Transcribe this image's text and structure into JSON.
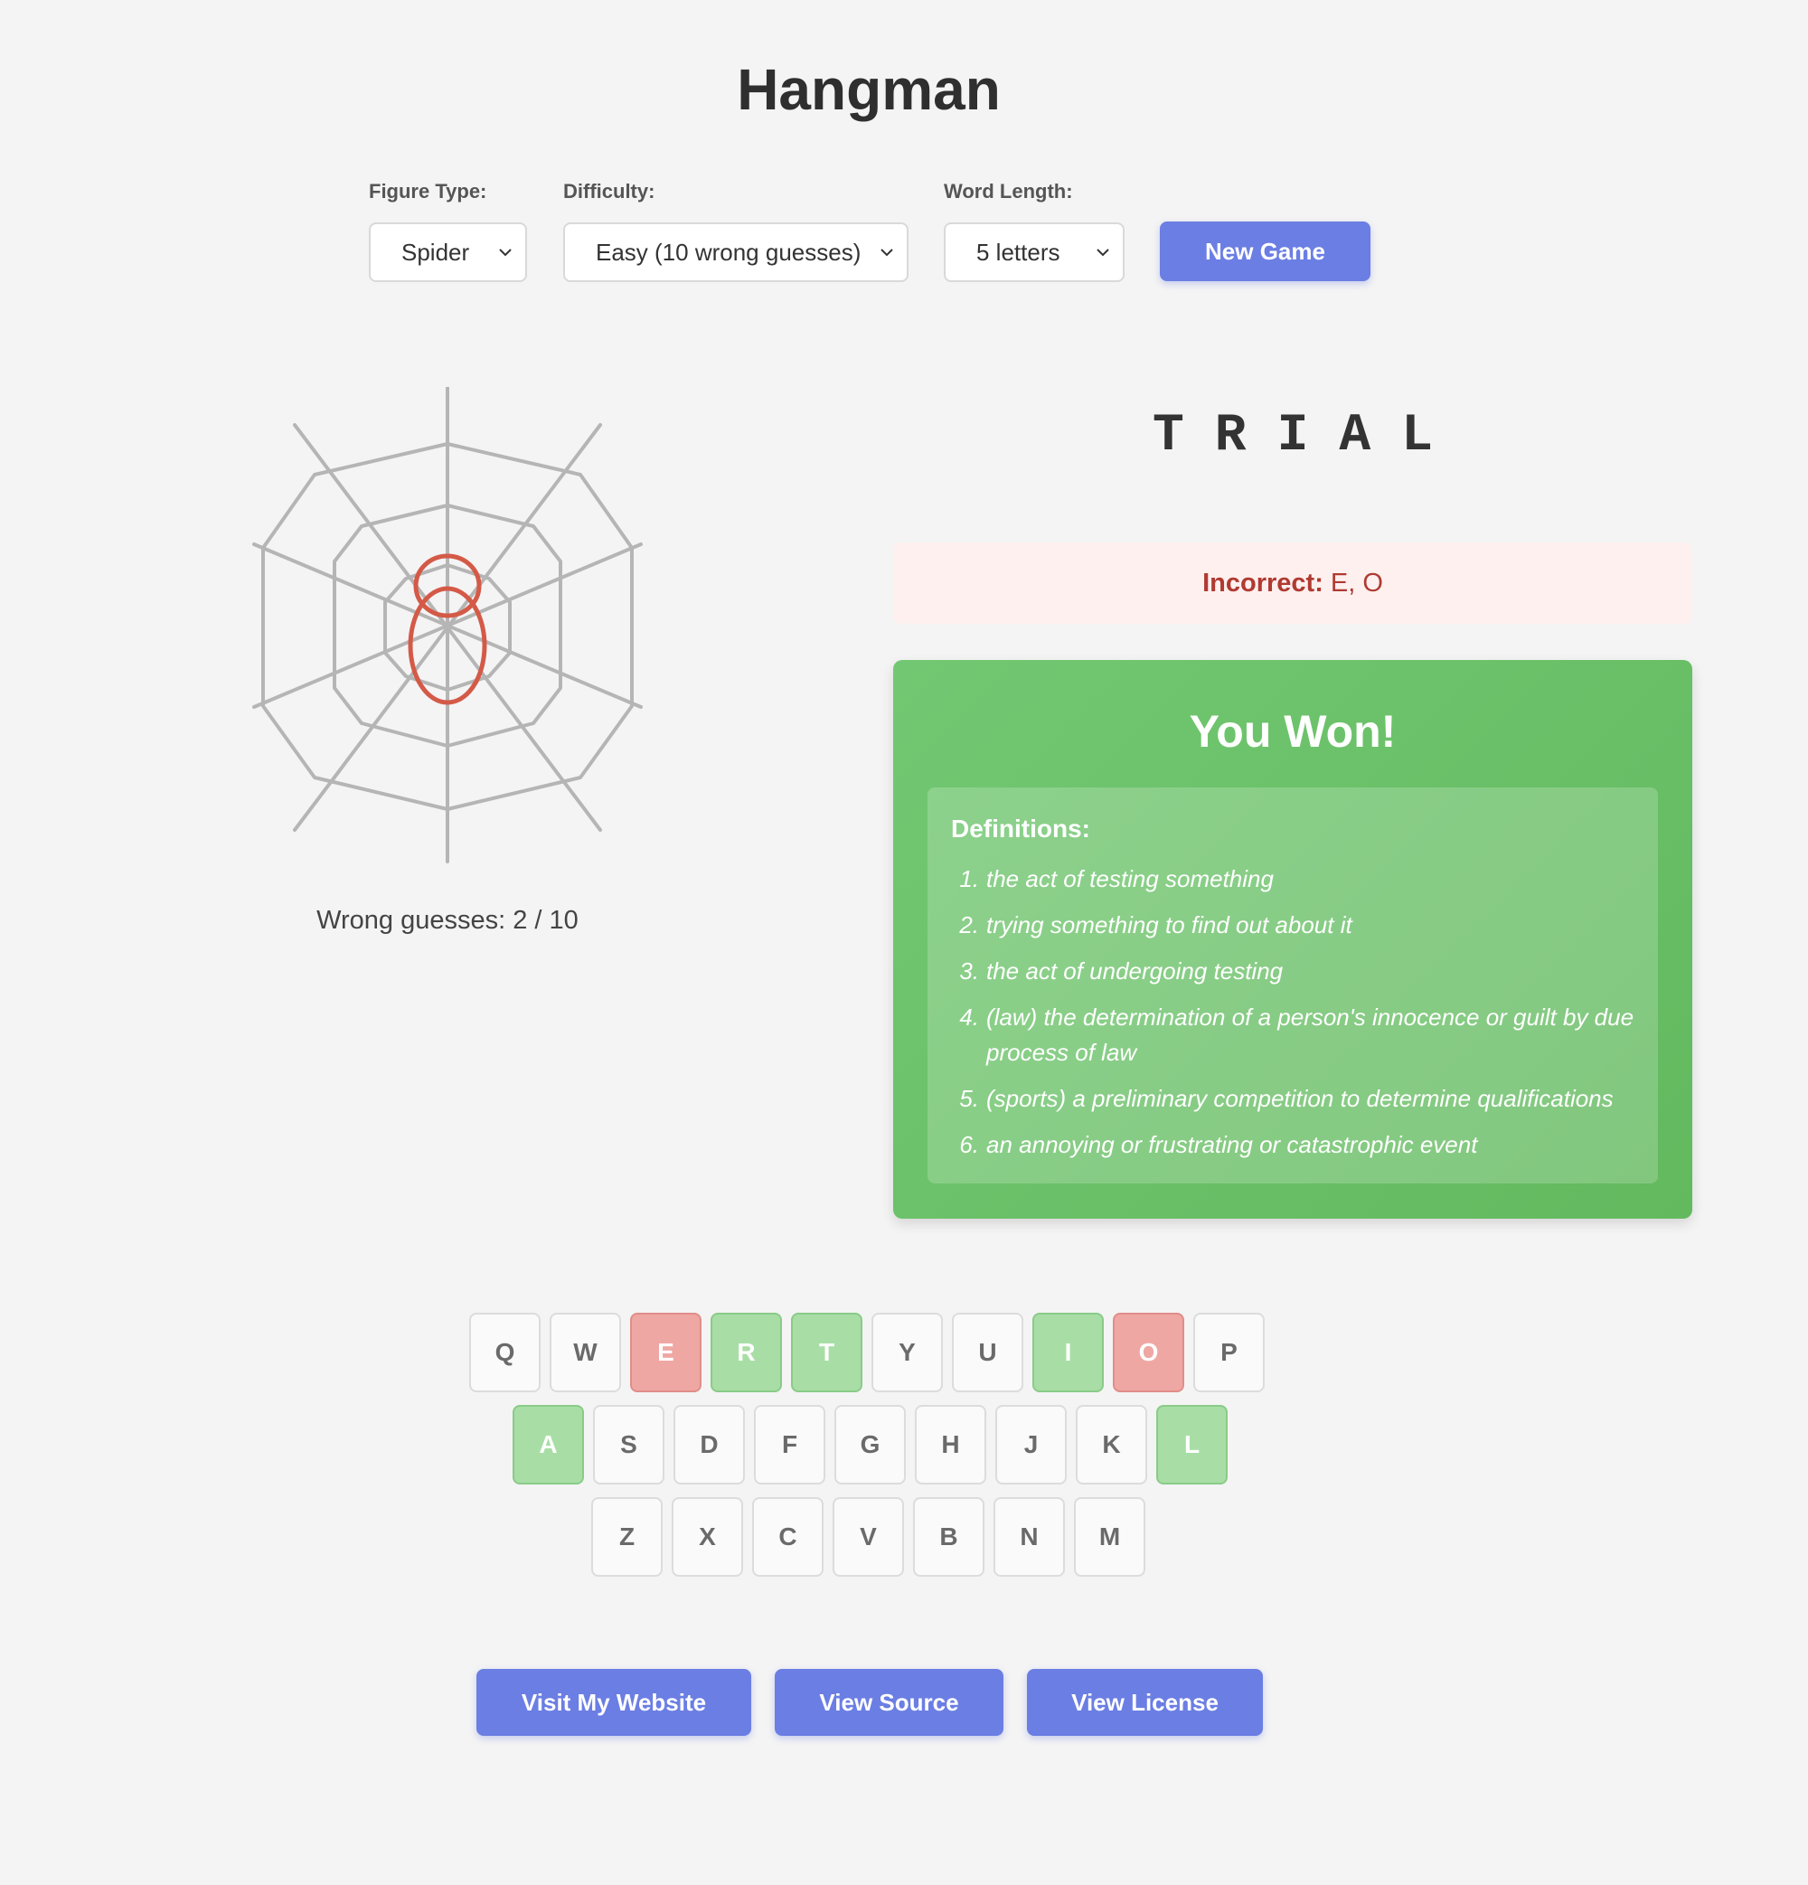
{
  "page": {
    "title": "Hangman"
  },
  "controls": {
    "figure_type": {
      "label": "Figure Type:",
      "value": "Spider"
    },
    "difficulty": {
      "label": "Difficulty:",
      "value": "Easy (10 wrong guesses)"
    },
    "word_length": {
      "label": "Word Length:",
      "value": "5 letters"
    },
    "new_game": "New Game"
  },
  "game": {
    "word": "TRIAL",
    "wrong_guesses_text": "Wrong guesses: 2 / 10",
    "incorrect_label": "Incorrect:",
    "incorrect_letters": "E, O"
  },
  "result": {
    "title": "You Won!",
    "definitions_heading": "Definitions:",
    "definitions": [
      "the act of testing something",
      "trying something to find out about it",
      "the act of undergoing testing",
      "(law) the determination of a person's innocence or guilt by due process of law",
      "(sports) a preliminary competition to determine qualifications",
      "an annoying or frustrating or catastrophic event"
    ]
  },
  "keyboard": {
    "rows": [
      [
        {
          "letter": "Q",
          "state": "unused"
        },
        {
          "letter": "W",
          "state": "unused"
        },
        {
          "letter": "E",
          "state": "incorrect"
        },
        {
          "letter": "R",
          "state": "correct"
        },
        {
          "letter": "T",
          "state": "correct"
        },
        {
          "letter": "Y",
          "state": "unused"
        },
        {
          "letter": "U",
          "state": "unused"
        },
        {
          "letter": "I",
          "state": "correct"
        },
        {
          "letter": "O",
          "state": "incorrect"
        },
        {
          "letter": "P",
          "state": "unused"
        }
      ],
      [
        {
          "letter": "A",
          "state": "correct"
        },
        {
          "letter": "S",
          "state": "unused"
        },
        {
          "letter": "D",
          "state": "unused"
        },
        {
          "letter": "F",
          "state": "unused"
        },
        {
          "letter": "G",
          "state": "unused"
        },
        {
          "letter": "H",
          "state": "unused"
        },
        {
          "letter": "J",
          "state": "unused"
        },
        {
          "letter": "K",
          "state": "unused"
        },
        {
          "letter": "L",
          "state": "correct"
        }
      ],
      [
        {
          "letter": "Z",
          "state": "unused"
        },
        {
          "letter": "X",
          "state": "unused"
        },
        {
          "letter": "C",
          "state": "unused"
        },
        {
          "letter": "V",
          "state": "unused"
        },
        {
          "letter": "B",
          "state": "unused"
        },
        {
          "letter": "N",
          "state": "unused"
        },
        {
          "letter": "M",
          "state": "unused"
        }
      ]
    ]
  },
  "footer": {
    "website": "Visit My Website",
    "source": "View Source",
    "license": "View License"
  },
  "colors": {
    "accent": "#6b7ee3",
    "correct": "#a8dea6",
    "incorrect": "#efa7a3",
    "won_bg": "#6cc26a",
    "spider": "#d45a48",
    "web": "#b5b5b5"
  },
  "icons": {
    "dropdown": "chevron-down-icon",
    "figure": "spider-web-figure"
  }
}
